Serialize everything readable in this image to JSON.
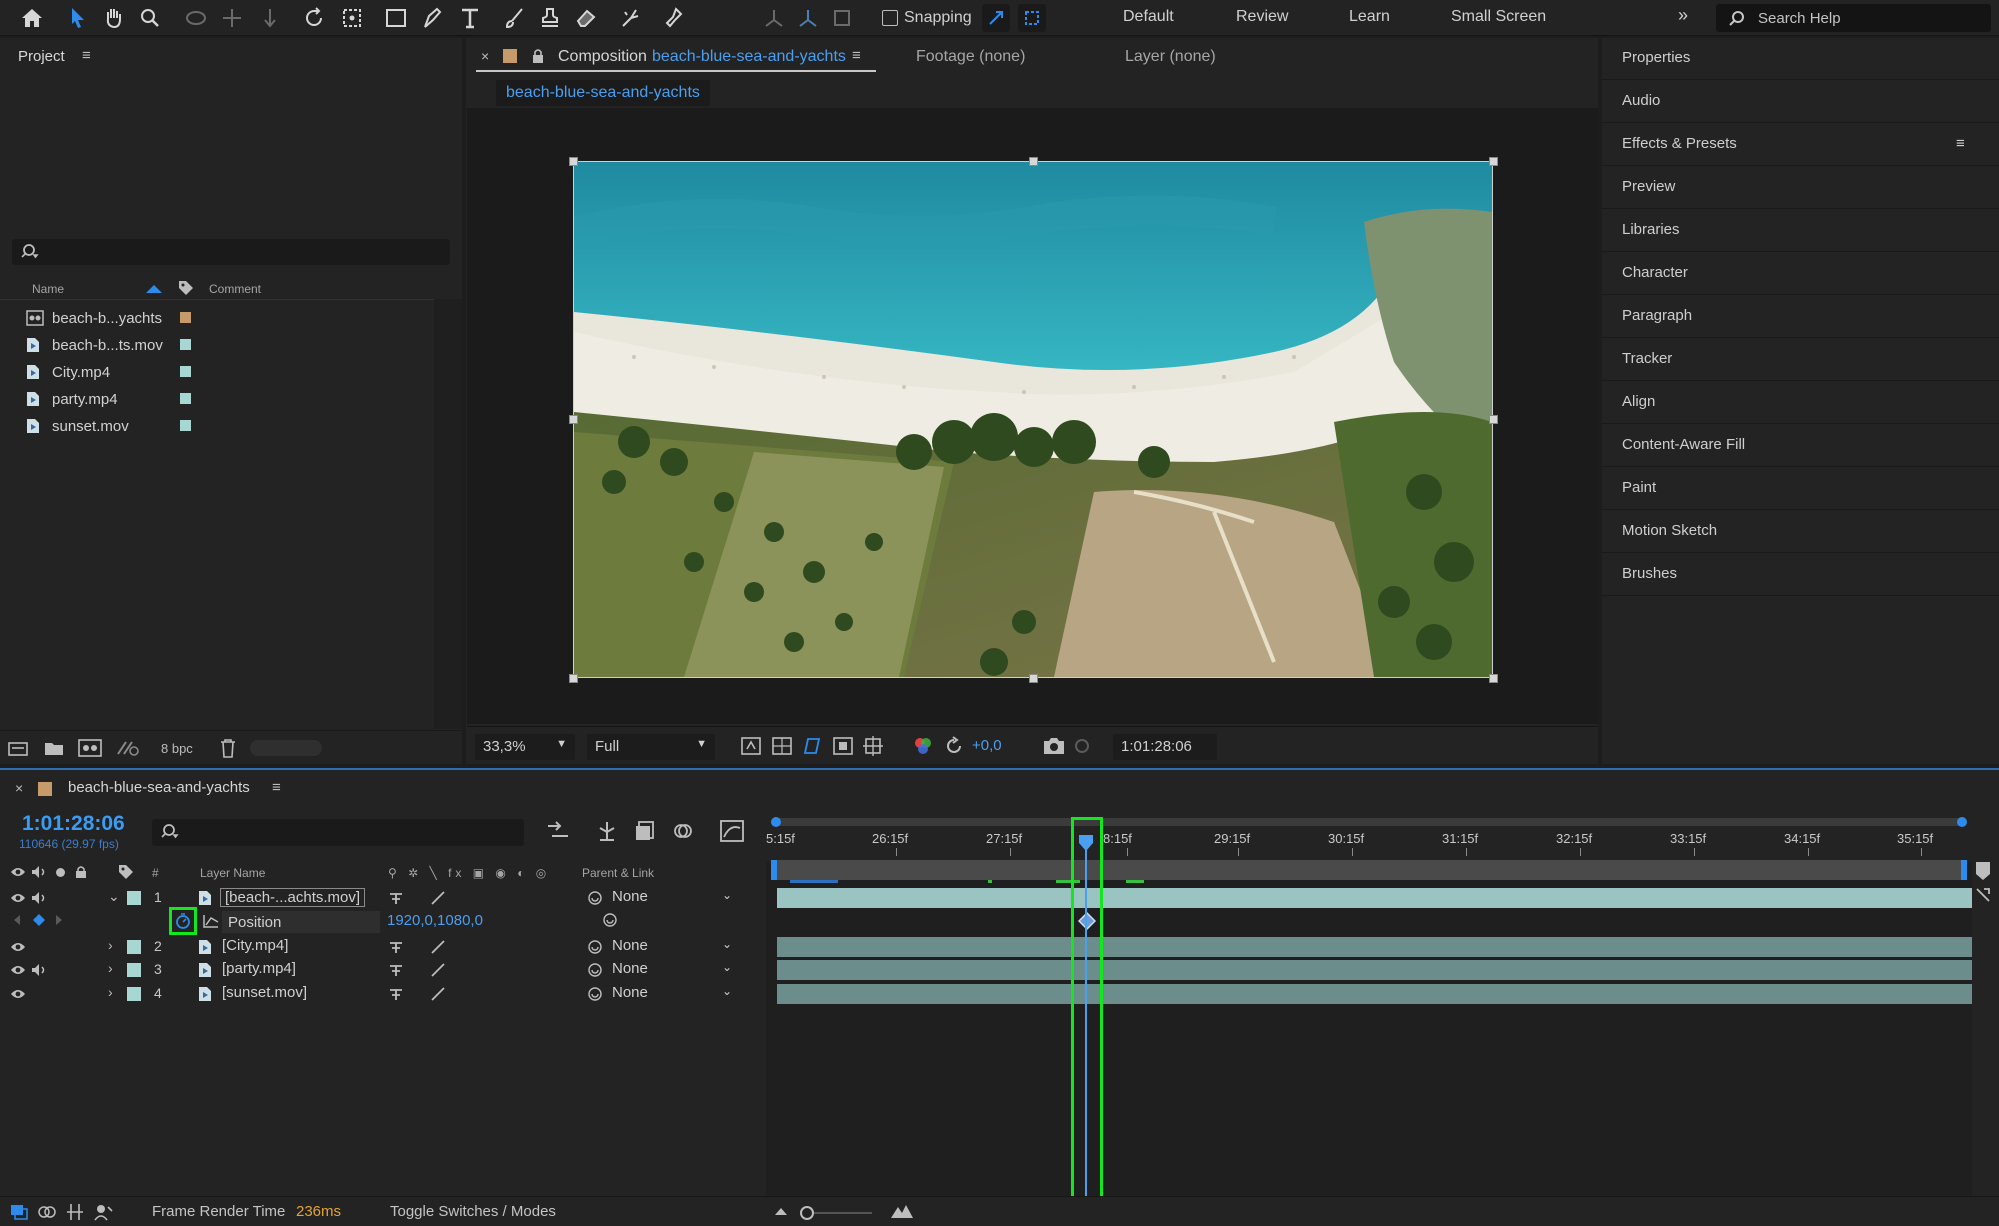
{
  "toolbar": {
    "snapping_label": "Snapping",
    "workspaces": [
      "Default",
      "Review",
      "Learn",
      "Small Screen"
    ],
    "search_placeholder": "Search Help"
  },
  "project": {
    "title": "Project",
    "columns": {
      "name": "Name",
      "comment": "Comment"
    },
    "items": [
      {
        "name": "beach-b...yachts",
        "icon": "composition-icon",
        "color": "#c79a6a"
      },
      {
        "name": "beach-b...ts.mov",
        "icon": "footage-icon",
        "color": "#a8d7d3"
      },
      {
        "name": "City.mp4",
        "icon": "footage-icon",
        "color": "#a8d7d3"
      },
      {
        "name": "party.mp4",
        "icon": "footage-icon",
        "color": "#a8d7d3"
      },
      {
        "name": "sunset.mov",
        "icon": "footage-icon",
        "color": "#a8d7d3"
      }
    ],
    "bpc": "8 bpc"
  },
  "composition": {
    "tab_prefix": "Composition",
    "tab_name": "beach-blue-sea-and-yachts",
    "footage_tab": "Footage (none)",
    "layer_tab": "Layer (none)",
    "subtab": "beach-blue-sea-and-yachts",
    "zoom": "33,3%",
    "resolution": "Full",
    "exposure": "+0,0",
    "timecode": "1:01:28:06"
  },
  "right_panels": [
    "Properties",
    "Audio",
    "Effects & Presets",
    "Preview",
    "Libraries",
    "Character",
    "Paragraph",
    "Tracker",
    "Align",
    "Content-Aware Fill",
    "Paint",
    "Motion Sketch",
    "Brushes"
  ],
  "timeline": {
    "comp_name": "beach-blue-sea-and-yachts",
    "timecode": "1:01:28:06",
    "frames": "110646 (29.97 fps)",
    "headers": {
      "num": "#",
      "layer_name": "Layer Name",
      "parent": "Parent & Link"
    },
    "ruler": [
      "5:15f",
      "26:15f",
      "27:15f",
      "8:15f",
      "29:15f",
      "30:15f",
      "31:15f",
      "32:15f",
      "33:15f",
      "34:15f",
      "35:15f"
    ],
    "layers": [
      {
        "num": "1",
        "name": "[beach-...achts.mov]",
        "parent": "None"
      },
      {
        "num": "2",
        "name": "[City.mp4]",
        "parent": "None"
      },
      {
        "num": "3",
        "name": "[party.mp4]",
        "parent": "None"
      },
      {
        "num": "4",
        "name": "[sunset.mov]",
        "parent": "None"
      }
    ],
    "property": {
      "name": "Position",
      "value": "1920,0,1080,0"
    },
    "frame_render_label": "Frame Render Time",
    "frame_render_value": "236ms",
    "toggle_label": "Toggle Switches / Modes"
  },
  "colors": {
    "accent": "#2d8ceb",
    "highlight": "#13e81c",
    "track": "#6b8d8c"
  }
}
